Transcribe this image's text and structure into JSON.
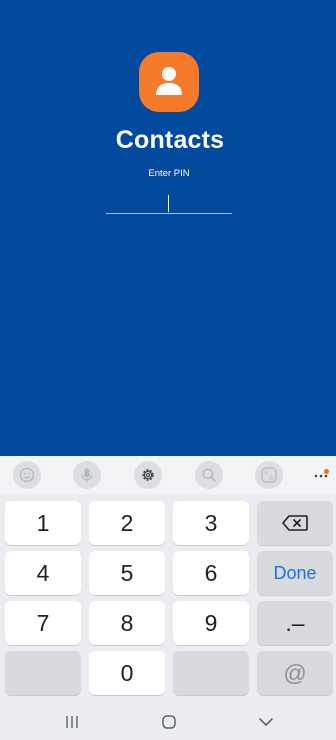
{
  "app": {
    "title": "Contacts",
    "pin_label": "Enter PIN",
    "pin_value": "",
    "icon": "contacts-person-icon",
    "background_color": "#034a9e",
    "icon_color": "#f57a2a"
  },
  "keyboard": {
    "toolbar": {
      "items": [
        "emoji-icon",
        "microphone-icon",
        "settings-icon",
        "search-icon",
        "translate-icon",
        "more-icon"
      ]
    },
    "keys": {
      "k1": "1",
      "k2": "2",
      "k3": "3",
      "k4": "4",
      "k5": "5",
      "k6": "6",
      "k7": "7",
      "k8": "8",
      "k9": "9",
      "k0": "0",
      "done": "Done",
      "punct": ".–",
      "at": "@"
    },
    "accent_color": "#1a73e8"
  },
  "navigation": {
    "items": [
      "recent-apps-icon",
      "home-icon",
      "back-icon"
    ]
  }
}
